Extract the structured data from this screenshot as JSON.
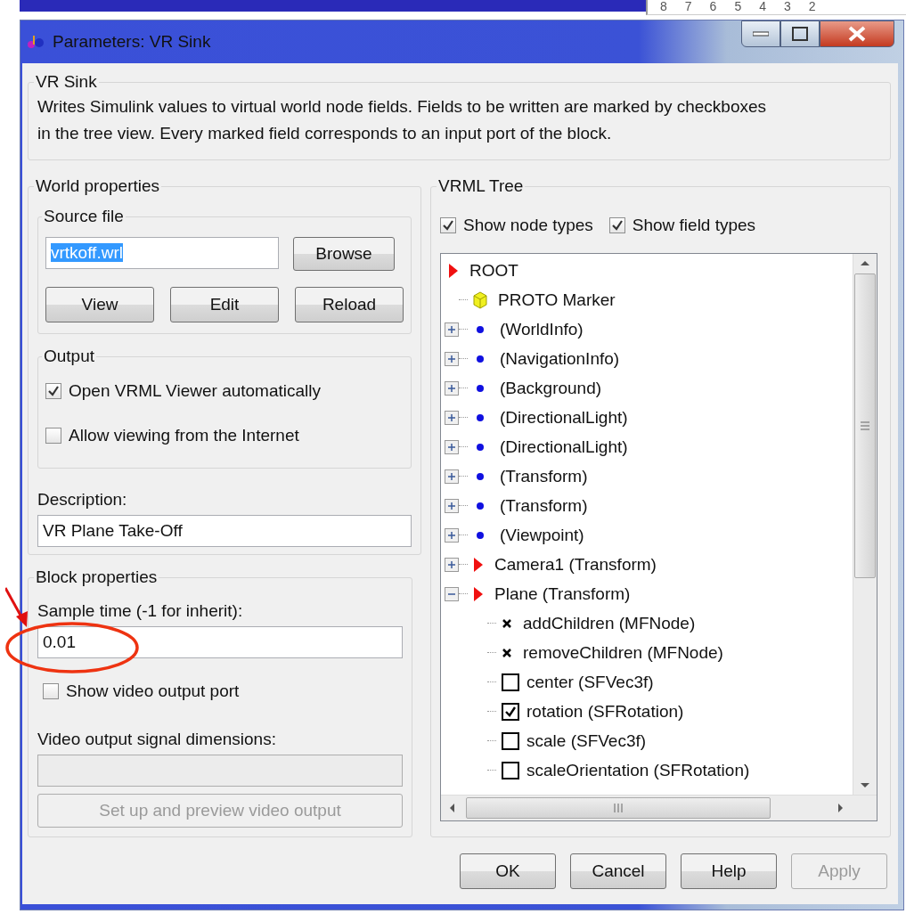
{
  "ruler": {
    "ticks": [
      "8",
      "7",
      "6",
      "5",
      "4",
      "3",
      "2"
    ]
  },
  "window": {
    "title": "Parameters: VR Sink"
  },
  "block_description": {
    "title": "VR Sink",
    "text": "Writes Simulink values to virtual world node fields. Fields to be written are marked by checkboxes in the tree view. Every marked field corresponds to an input port of the block."
  },
  "world_properties": {
    "title": "World properties",
    "source_file": {
      "title": "Source file",
      "value": "vrtkoff.wrl",
      "text_selected": true,
      "browse": "Browse",
      "buttons": [
        "View",
        "Edit",
        "Reload"
      ]
    },
    "output": {
      "title": "Output",
      "options": [
        {
          "label": "Open VRML Viewer automatically",
          "checked": true
        },
        {
          "label": "Allow viewing from the Internet",
          "checked": false
        }
      ]
    },
    "description": {
      "label": "Description:",
      "value": "VR Plane Take-Off"
    }
  },
  "block_properties": {
    "title": "Block properties",
    "sample_time": {
      "label": "Sample time (-1 for inherit):",
      "value": "0.01"
    },
    "video_port": {
      "label": "Show video output port",
      "checked": false
    },
    "video_dims": {
      "label": "Video output signal dimensions:",
      "disabled": true
    },
    "setup_button": {
      "label": "Set up and preview video output",
      "disabled": true
    }
  },
  "vrml_tree": {
    "title": "VRML Tree",
    "options": [
      {
        "label": "Show node types",
        "checked": true
      },
      {
        "label": "Show field types",
        "checked": true
      }
    ],
    "items": [
      {
        "kind": "root",
        "label": "ROOT",
        "children": [
          {
            "kind": "proto",
            "label": "PROTO Marker"
          },
          {
            "kind": "node",
            "label": "(WorldInfo)",
            "expanded": false
          },
          {
            "kind": "node",
            "label": "(NavigationInfo)",
            "expanded": false
          },
          {
            "kind": "node",
            "label": "(Background)",
            "expanded": false
          },
          {
            "kind": "node",
            "label": "(DirectionalLight)",
            "expanded": false
          },
          {
            "kind": "node",
            "label": "(DirectionalLight)",
            "expanded": false
          },
          {
            "kind": "node",
            "label": "(Transform)",
            "expanded": false
          },
          {
            "kind": "node",
            "label": "(Transform)",
            "expanded": false
          },
          {
            "kind": "node",
            "label": "(Viewpoint)",
            "expanded": false
          },
          {
            "kind": "transform",
            "label": "Camera1 (Transform)",
            "expanded": false
          },
          {
            "kind": "transform",
            "label": "Plane (Transform)",
            "expanded": true,
            "children": [
              {
                "kind": "event",
                "label": "addChildren (MFNode)"
              },
              {
                "kind": "event",
                "label": "removeChildren (MFNode)"
              },
              {
                "kind": "field",
                "label": "center (SFVec3f)",
                "checked": false
              },
              {
                "kind": "field",
                "label": "rotation (SFRotation)",
                "checked": true
              },
              {
                "kind": "field",
                "label": "scale (SFVec3f)",
                "checked": false
              },
              {
                "kind": "field",
                "label": "scaleOrientation (SFRotation)",
                "checked": false
              }
            ]
          }
        ]
      }
    ]
  },
  "dialog_buttons": [
    {
      "label": "OK",
      "disabled": false
    },
    {
      "label": "Cancel",
      "disabled": false
    },
    {
      "label": "Help",
      "disabled": false
    },
    {
      "label": "Apply",
      "disabled": true
    }
  ]
}
